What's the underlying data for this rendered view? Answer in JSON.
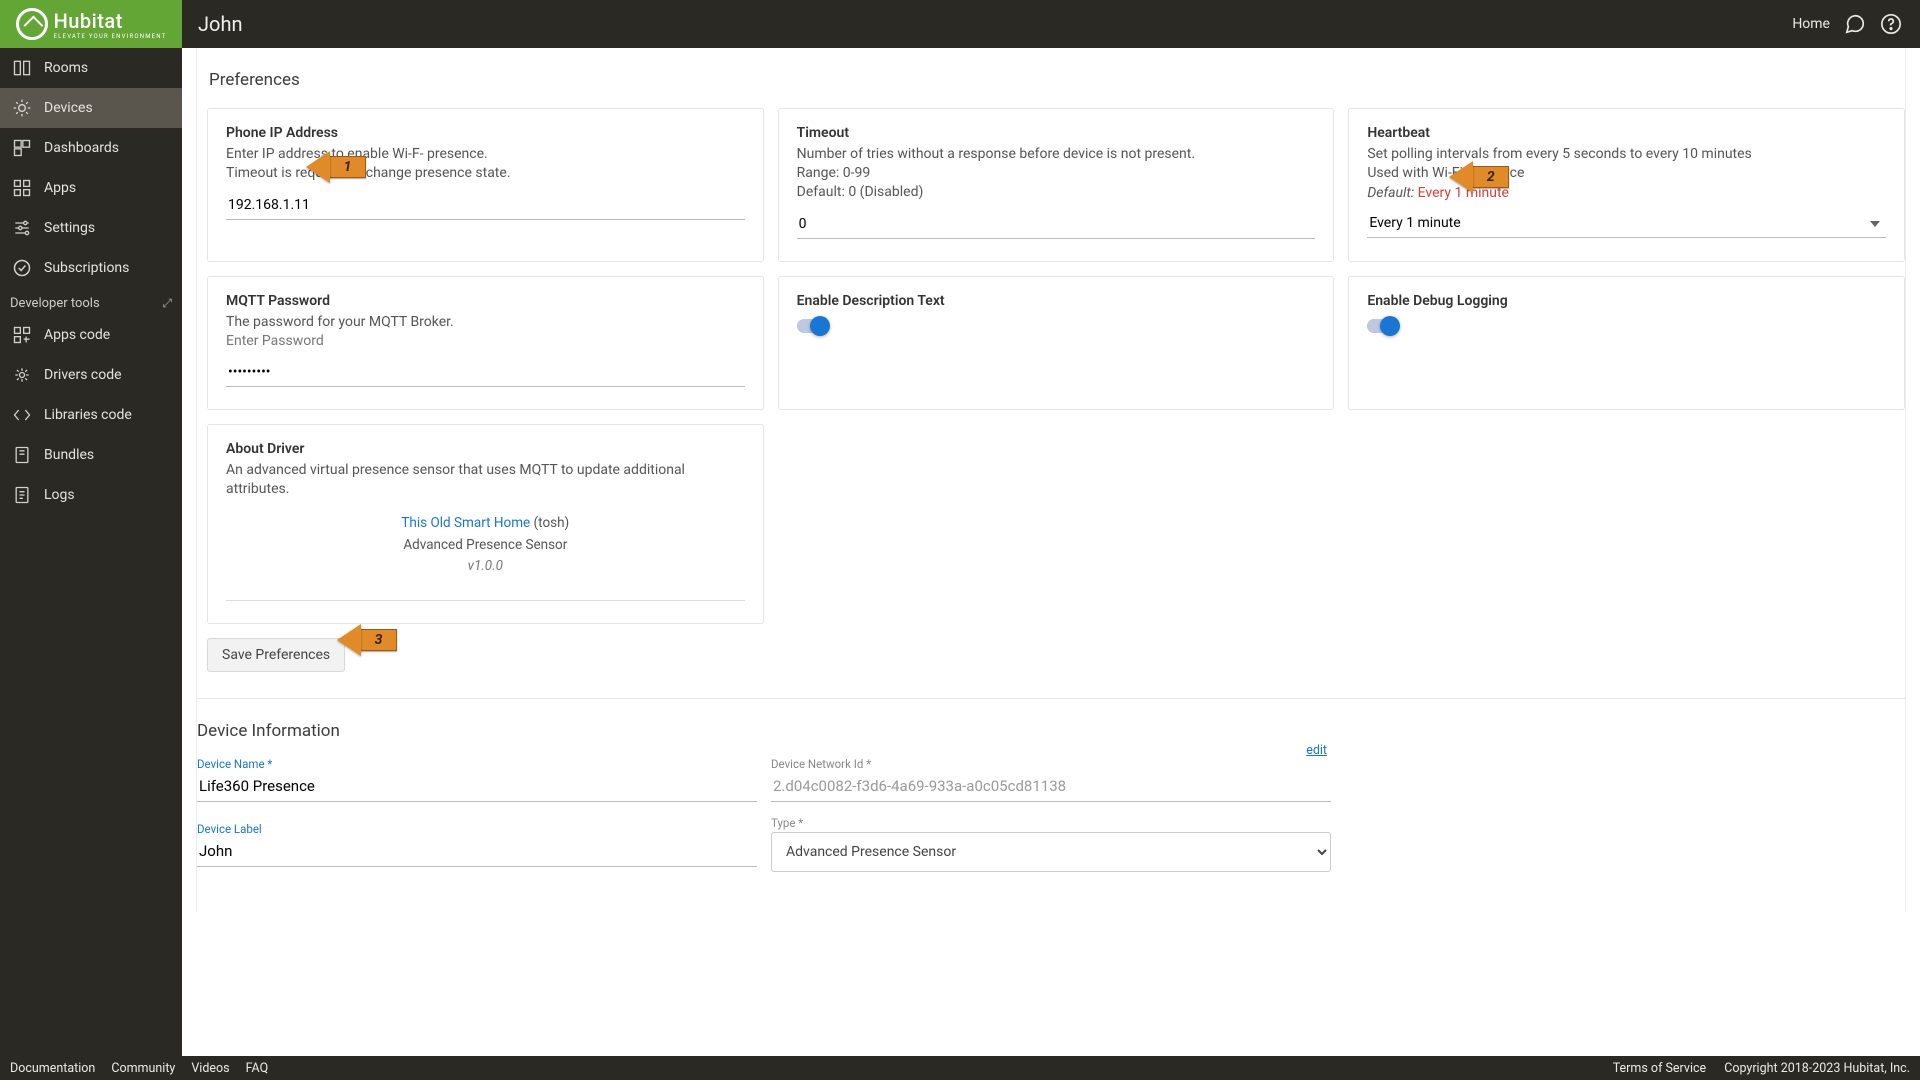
{
  "brand": {
    "name": "Hubitat",
    "tagline": "ELEVATE YOUR ENVIRONMENT"
  },
  "page_title": "John",
  "top_nav": {
    "home": "Home"
  },
  "sidebar": {
    "items": [
      {
        "label": "Rooms"
      },
      {
        "label": "Devices"
      },
      {
        "label": "Dashboards"
      },
      {
        "label": "Apps"
      },
      {
        "label": "Settings"
      },
      {
        "label": "Subscriptions"
      }
    ],
    "dev_tools_label": "Developer tools",
    "dev_items": [
      {
        "label": "Apps code"
      },
      {
        "label": "Drivers code"
      },
      {
        "label": "Libraries code"
      },
      {
        "label": "Bundles"
      },
      {
        "label": "Logs"
      }
    ]
  },
  "footer": {
    "left": [
      "Documentation",
      "Community",
      "Videos",
      "FAQ"
    ],
    "right": [
      "Terms of Service",
      "Copyright 2018-2023 Hubitat, Inc."
    ]
  },
  "preferences": {
    "section_title": "Preferences",
    "phone_ip": {
      "title": "Phone IP Address",
      "desc1": "Enter IP address to enable Wi-F- presence.",
      "desc2": "Timeout is required to change presence state.",
      "value": "192.168.1.11"
    },
    "timeout": {
      "title": "Timeout",
      "desc1": "Number of tries without a response before device is not present.",
      "desc2": "Range: 0-99",
      "desc3": "Default: 0 (Disabled)",
      "value": "0"
    },
    "heartbeat": {
      "title": "Heartbeat",
      "desc1": "Set polling intervals from every 5 seconds to every 10 minutes",
      "desc2": "Used with Wi-Fi Presence",
      "default_label": "Default:",
      "default_value": "Every 1 minute",
      "selected": "Every 1 minute"
    },
    "mqtt": {
      "title": "MQTT Password",
      "desc": "The password for your MQTT Broker.",
      "placeholder": "Enter Password",
      "value": "•••••••••"
    },
    "enable_desc": {
      "title": "Enable Description Text"
    },
    "enable_debug": {
      "title": "Enable Debug Logging"
    },
    "about": {
      "title": "About Driver",
      "desc": "An advanced virtual presence sensor that uses MQTT to update additional attributes.",
      "link_text": "This Old Smart Home",
      "link_suffix": " (tosh)",
      "name": "Advanced Presence Sensor",
      "version": "v1.0.0"
    },
    "save_button": "Save Preferences"
  },
  "device_info": {
    "section_title": "Device Information",
    "name_label": "Device Name *",
    "name_value": "Life360 Presence",
    "label_label": "Device Label",
    "label_value": "John",
    "network_id_label": "Device Network Id *",
    "network_id_value": "2.d04c0082-f3d6-4a69-933a-a0c05cd81138",
    "edit": "edit",
    "type_label": "Type *",
    "type_value": "Advanced Presence Sensor"
  },
  "callouts": {
    "c1": "1",
    "c2": "2",
    "c3": "3"
  }
}
